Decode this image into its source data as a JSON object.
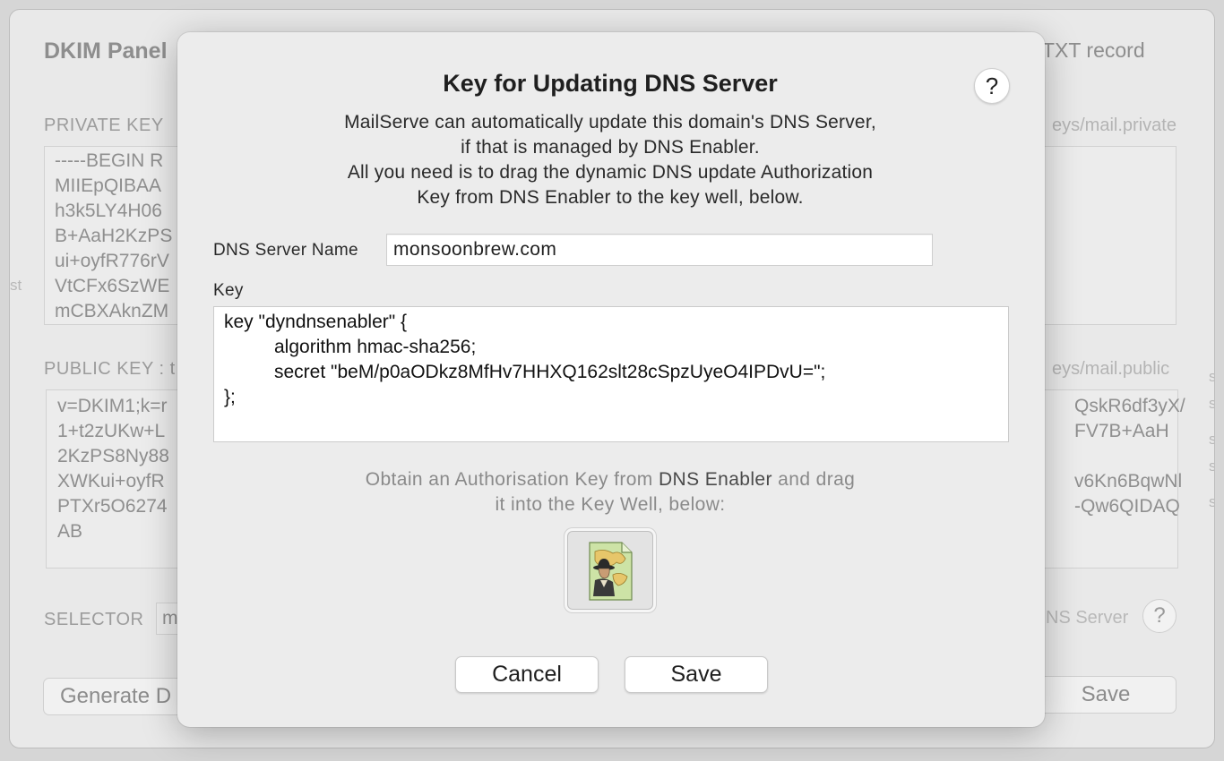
{
  "background": {
    "title": "DKIM Panel",
    "right_title": "TXT record",
    "private_key_label": "PRIVATE KEY",
    "private_key_path": "eys/mail.private",
    "private_key_lines": [
      "-----BEGIN R",
      "MIIEpQIBAA",
      "h3k5LY4H06",
      "B+AaH2KzPS",
      "ui+oyfR776rV",
      "VtCFx6SzWE",
      "mCBXAknZM"
    ],
    "public_key_label": "PUBLIC KEY : t",
    "public_key_path": "eys/mail.public",
    "public_key_lines_left": [
      "v=DKIM1;k=r",
      "1+t2zUKw+L",
      "2KzPS8Ny88",
      "XWKui+oyfR",
      "PTXr5O6274",
      "AB"
    ],
    "public_key_lines_right": [
      "QskR6df3yX/",
      "FV7B+AaH",
      "",
      "v6Kn6BqwNl",
      "-Qw6QIDAQ"
    ],
    "selector_label": "SELECTOR",
    "selector_value": "m",
    "dns_server_text": "NS Server",
    "generate_label": "Generate D",
    "save_label": "Save",
    "help_label": "?"
  },
  "dialog": {
    "title": "Key for Updating DNS Server",
    "help_label": "?",
    "intro_lines": [
      "MailServe can automatically update this domain's DNS Server,",
      "if that is managed by DNS Enabler.",
      "All you need is to drag the dynamic DNS update Authorization",
      "Key from DNS Enabler to the key well, below."
    ],
    "server_name_label": "DNS Server Name",
    "server_name_value": "monsoonbrew.com",
    "key_label": "Key",
    "key_lines": [
      "key \"dyndnsenabler\" {",
      "algorithm hmac-sha256;",
      "secret \"beM/p0aODkz8MfHv7HHXQ162slt28cSpzUyeO4IPDvU=\";",
      "};"
    ],
    "obtain_prefix": "Obtain an Authorisation Key from ",
    "obtain_app": "DNS Enabler",
    "obtain_suffix": " and drag",
    "obtain_line2": "it into the Key Well, below:",
    "key_well_icon": "dns-key-file-icon",
    "cancel_label": "Cancel",
    "save_label": "Save"
  }
}
